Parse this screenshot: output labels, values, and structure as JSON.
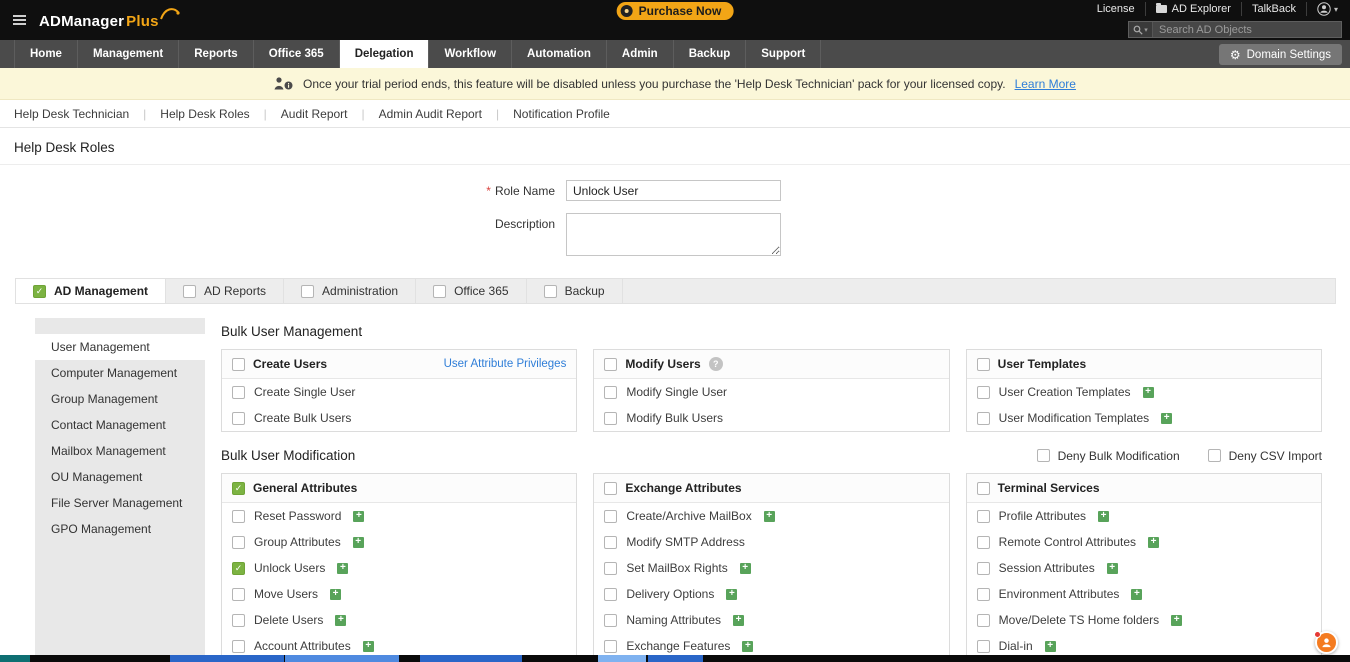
{
  "topbar": {
    "brand": "ADManager",
    "brand_suffix": "Plus",
    "purchase_label": "Purchase Now",
    "links": [
      "License",
      "AD Explorer",
      "TalkBack"
    ],
    "search_placeholder": "Search AD Objects"
  },
  "nav": {
    "tabs": [
      {
        "label": "Home"
      },
      {
        "label": "Management"
      },
      {
        "label": "Reports"
      },
      {
        "label": "Office 365"
      },
      {
        "label": "Delegation",
        "active": true
      },
      {
        "label": "Workflow"
      },
      {
        "label": "Automation"
      },
      {
        "label": "Admin"
      },
      {
        "label": "Backup"
      },
      {
        "label": "Support"
      }
    ],
    "domain_settings_label": "Domain Settings"
  },
  "notice": {
    "text": "Once your trial period ends, this feature will be disabled unless you purchase the 'Help Desk Technician' pack for your licensed copy.",
    "link_label": "Learn More"
  },
  "subnav": {
    "items": [
      "Help Desk Technician",
      "Help Desk Roles",
      "Audit Report",
      "Admin Audit Report",
      "Notification Profile"
    ]
  },
  "page": {
    "title": "Help Desk Roles"
  },
  "form": {
    "required_marker": "*",
    "role_name_label": "Role Name",
    "role_name_value": "Unlock User",
    "description_label": "Description",
    "description_value": ""
  },
  "perm_tabs": [
    {
      "label": "AD Management",
      "checked": true,
      "active": true
    },
    {
      "label": "AD Reports",
      "checked": false
    },
    {
      "label": "Administration",
      "checked": false
    },
    {
      "label": "Office 365",
      "checked": false
    },
    {
      "label": "Backup",
      "checked": false
    }
  ],
  "sidebar": {
    "items": [
      {
        "label": "User Management",
        "active": true
      },
      {
        "label": "Computer Management"
      },
      {
        "label": "Group Management"
      },
      {
        "label": "Contact Management"
      },
      {
        "label": "Mailbox Management"
      },
      {
        "label": "OU Management"
      },
      {
        "label": "File Server Management"
      },
      {
        "label": "GPO Management"
      }
    ]
  },
  "sections": [
    {
      "title": "Bulk User Management",
      "deny_options": [],
      "groups": [
        {
          "title": "Create Users",
          "checked": false,
          "header_link": "User Attribute Privileges",
          "items": [
            {
              "label": "Create Single User",
              "checked": false,
              "plus": false
            },
            {
              "label": "Create Bulk Users",
              "checked": false,
              "plus": false
            }
          ]
        },
        {
          "title": "Modify Users",
          "checked": false,
          "help": true,
          "items": [
            {
              "label": "Modify Single User",
              "checked": false,
              "plus": false
            },
            {
              "label": "Modify Bulk Users",
              "checked": false,
              "plus": false
            }
          ]
        },
        {
          "title": "User Templates",
          "checked": false,
          "items": [
            {
              "label": "User Creation Templates",
              "checked": false,
              "plus": true
            },
            {
              "label": "User Modification Templates",
              "checked": false,
              "plus": true
            }
          ]
        }
      ]
    },
    {
      "title": "Bulk User Modification",
      "deny_options": [
        "Deny Bulk Modification",
        "Deny CSV Import"
      ],
      "groups": [
        {
          "title": "General Attributes",
          "checked": true,
          "items": [
            {
              "label": "Reset Password",
              "checked": false,
              "plus": true
            },
            {
              "label": "Group Attributes",
              "checked": false,
              "plus": true
            },
            {
              "label": "Unlock Users",
              "checked": true,
              "plus": true
            },
            {
              "label": "Move Users",
              "checked": false,
              "plus": true
            },
            {
              "label": "Delete Users",
              "checked": false,
              "plus": true
            },
            {
              "label": "Account Attributes",
              "checked": false,
              "plus": true
            }
          ]
        },
        {
          "title": "Exchange Attributes",
          "checked": false,
          "items": [
            {
              "label": "Create/Archive MailBox",
              "checked": false,
              "plus": true
            },
            {
              "label": "Modify SMTP Address",
              "checked": false,
              "plus": false
            },
            {
              "label": "Set MailBox Rights",
              "checked": false,
              "plus": true
            },
            {
              "label": "Delivery Options",
              "checked": false,
              "plus": true
            },
            {
              "label": "Naming Attributes",
              "checked": false,
              "plus": true
            },
            {
              "label": "Exchange Features",
              "checked": false,
              "plus": true
            }
          ]
        },
        {
          "title": "Terminal Services",
          "checked": false,
          "items": [
            {
              "label": "Profile Attributes",
              "checked": false,
              "plus": true
            },
            {
              "label": "Remote Control Attributes",
              "checked": false,
              "plus": true
            },
            {
              "label": "Session Attributes",
              "checked": false,
              "plus": true
            },
            {
              "label": "Environment Attributes",
              "checked": false,
              "plus": true
            },
            {
              "label": "Move/Delete TS Home folders",
              "checked": false,
              "plus": true
            },
            {
              "label": "Dial-in",
              "checked": false,
              "plus": true
            }
          ]
        }
      ]
    }
  ],
  "glyphs": {
    "check": "✓",
    "plus": "+",
    "separator": "|",
    "caret": "▾",
    "question": "?",
    "gear": "⚙"
  },
  "colors": {
    "brand_yellow": "#f2a516",
    "checked_green": "#7cb342",
    "link_blue": "#2f7ed8",
    "notice_bg": "#fbf7d9"
  }
}
